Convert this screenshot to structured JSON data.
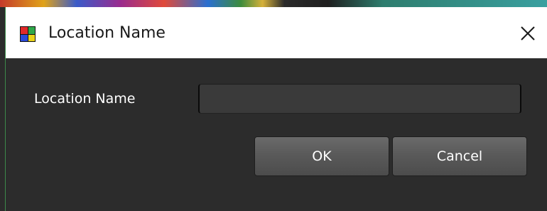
{
  "window": {
    "title": "Location Name",
    "icon": "app-grid-icon",
    "close_icon": "close-icon"
  },
  "form": {
    "field_label": "Location Name",
    "field_value": "",
    "field_placeholder": ""
  },
  "buttons": {
    "ok_label": "OK",
    "cancel_label": "Cancel"
  },
  "colors": {
    "title_bar": "#ffffff",
    "dialog_body": "#2c2c2c",
    "button": "#5a5a5a",
    "text": "#ffffff"
  }
}
